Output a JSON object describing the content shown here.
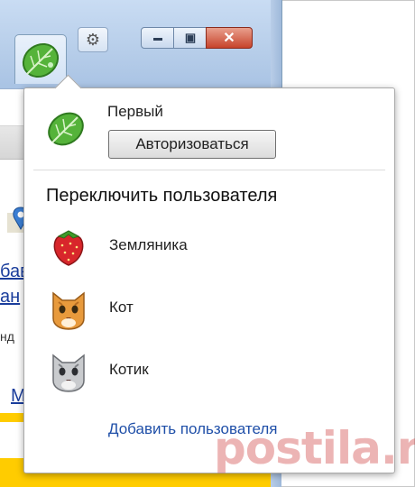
{
  "window": {
    "minimize_glyph": "▬",
    "maximize_glyph": "▣",
    "close_glyph": "✕",
    "gear_glyph": "⚙",
    "page": {
      "link1": "бав",
      "link2": "ан",
      "text1": "нд",
      "link3": "М"
    }
  },
  "popup": {
    "current_user": {
      "name": "Первый",
      "avatar": "leaf-icon"
    },
    "sign_in_label": "Авторизоваться",
    "switch_heading": "Переключить пользователя",
    "users": [
      {
        "name": "Земляника",
        "avatar": "strawberry-icon"
      },
      {
        "name": "Кот",
        "avatar": "orange-cat-icon"
      },
      {
        "name": "Котик",
        "avatar": "gray-cat-icon"
      }
    ],
    "add_user_label": "Добавить пользователя"
  },
  "watermark": "postila.ru",
  "colors": {
    "accent_link": "#1f4fa8",
    "titlebar": "#b6cde9",
    "close": "#c7432b",
    "yellow": "#ffcc00"
  }
}
